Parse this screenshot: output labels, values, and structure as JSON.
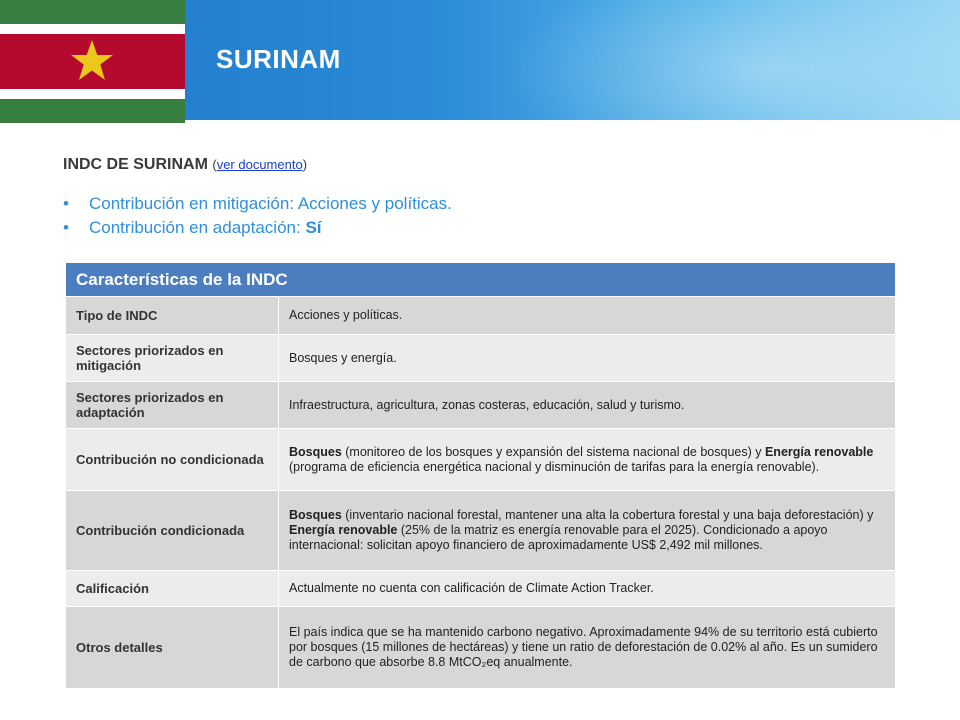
{
  "header": {
    "title": "SURINAM",
    "flag_icon": "suriname-flag-icon"
  },
  "subheading": {
    "title": "INDC DE SURINAM",
    "paren_open": "(",
    "link": "ver documento",
    "paren_close": ")"
  },
  "bullets": {
    "item1": "Contribución en mitigación: Acciones y políticas.",
    "item2_prefix": "Contribución en adaptación: ",
    "item2_value": "Sí"
  },
  "table": {
    "header": "Características de la INDC",
    "rows": [
      {
        "label": "Tipo de INDC",
        "value": "Acciones y políticas."
      },
      {
        "label": "Sectores priorizados en mitigación",
        "value": "Bosques y energía."
      },
      {
        "label": "Sectores priorizados en adaptación",
        "value": "Infraestructura, agricultura, zonas costeras, educación, salud y turismo."
      },
      {
        "label": "Contribución no condicionada",
        "b1": "Bosques",
        "t1": " (monitoreo de los bosques y expansión del sistema nacional de bosques) y ",
        "b2": "Energía renovable",
        "t2": " (programa de eficiencia energética nacional y disminución de tarifas para la energía renovable)."
      },
      {
        "label": "Contribución condicionada",
        "b1": "Bosques",
        "t1": " (inventario nacional forestal, mantener una alta la cobertura forestal y una baja deforestación) y ",
        "b2": "Energía renovable",
        "t2": " (25% de la matriz es energía renovable para el 2025). Condicionado a apoyo internacional: solicitan apoyo financiero de aproximadamente US$ 2,492 mil millones."
      },
      {
        "label": "Calificación",
        "value": "Actualmente no cuenta con calificación de Climate Action Tracker."
      },
      {
        "label": "Otros detalles",
        "value": "El país indica que se ha mantenido carbono negativo. Aproximadamente 94% de su territorio está cubierto por bosques (15 millones de hectáreas) y tiene un ratio de deforestación de 0.02% al año. Es un sumidero de carbono que absorbe 8.8 MtCO₂eq anualmente."
      }
    ]
  },
  "colors": {
    "banner": "#2a8bd8",
    "table_header": "#4c7dbf",
    "bullet_text": "#2f8fd8",
    "flag_green": "#377e3f",
    "flag_red": "#b40a2d",
    "flag_star": "#ecc81d"
  }
}
